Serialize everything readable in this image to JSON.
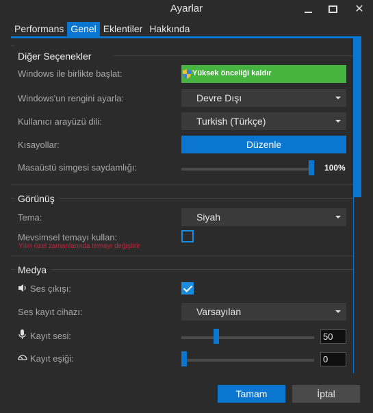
{
  "window": {
    "title": "Ayarlar",
    "minimize_icon": "minimize-icon",
    "maximize_icon": "maximize-icon",
    "close_icon": "close-icon",
    "close_glyph": "✕"
  },
  "tabs": [
    {
      "label": "Performans",
      "active": false
    },
    {
      "label": "Genel",
      "active": true
    },
    {
      "label": "Eklentiler",
      "active": false
    },
    {
      "label": "Hakkında",
      "active": false
    }
  ],
  "other_options": {
    "title": "Diğer Seçenekler",
    "startup_label": "Windows ile birlikte başlat:",
    "startup_button": "Yüksek önceliği kaldır",
    "win_color_label": "Windows'un rengini ayarla:",
    "win_color_value": "Devre Dışı",
    "ui_lang_label": "Kullanıcı arayüzü dili:",
    "ui_lang_value": "Turkish (Türkçe)",
    "shortcuts_label": "Kısayollar:",
    "shortcuts_button": "Düzenle",
    "desktop_opacity_label": "Masaüstü simgesi saydamlığı:",
    "desktop_opacity_value": "100%",
    "desktop_opacity_level": 1.0
  },
  "appearance": {
    "title": "Görünüş",
    "theme_label": "Tema:",
    "theme_value": "Siyah",
    "seasonal_label": "Mevsimsel temayı kullan:",
    "seasonal_note": "Yılın özel zamanlarında temayı değiştirir",
    "seasonal_checked": false
  },
  "media": {
    "title": "Medya",
    "sound_output_label": "Ses çıkışı:",
    "sound_output_icon": "speaker-icon",
    "sound_output_checked": true,
    "record_device_label": "Ses kayıt cihazı:",
    "record_device_value": "Varsayılan",
    "record_volume_label": "Kayıt sesi:",
    "record_volume_icon": "microphone-icon",
    "record_volume_value": "50",
    "record_volume_level": 0.25,
    "record_threshold_label": "Kayıt eşiği:",
    "record_threshold_icon": "gauge-icon",
    "record_threshold_value": "0",
    "record_threshold_level": 0.0
  },
  "footer": {
    "ok_label": "Tamam",
    "cancel_label": "İptal"
  },
  "colors": {
    "accent": "#0a76d0",
    "green_button": "#46b53f",
    "note_red": "#c0283c",
    "background": "#2b2b2b"
  }
}
